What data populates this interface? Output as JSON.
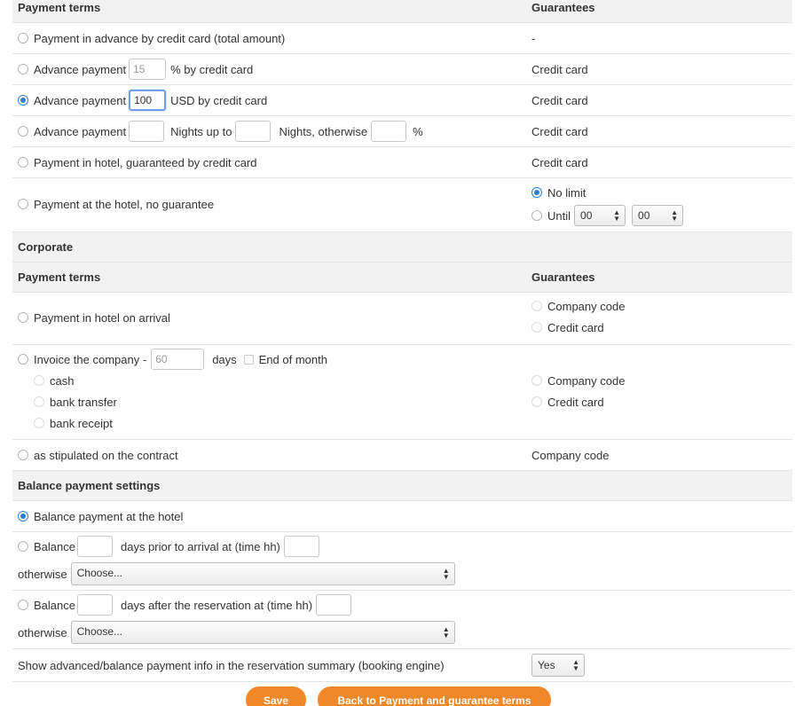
{
  "section_headers": {
    "payment_terms": "Payment terms",
    "guarantees": "Guarantees",
    "corporate": "Corporate",
    "corporate_payment_terms": "Payment terms",
    "corporate_guarantees": "Guarantees",
    "balance_settings": "Balance payment settings"
  },
  "payment_options": {
    "advance_total": {
      "label": "Payment in advance by credit card (total amount)",
      "guarantee": "-"
    },
    "advance_percent": {
      "label": "Advance payment",
      "value": "15",
      "suffix": "% by credit card",
      "guarantee": "Credit card"
    },
    "advance_usd": {
      "label": "Advance payment",
      "value": "100",
      "suffix": "USD by credit card",
      "guarantee": "Credit card"
    },
    "advance_nights": {
      "label": "Advance payment",
      "mid": "Nights up to",
      "end": "Nights, otherwise",
      "percent": "%",
      "guarantee": "Credit card"
    },
    "hotel_guaranteed": {
      "label": "Payment in hotel, guaranteed by credit card",
      "guarantee": "Credit card"
    },
    "hotel_no_guarantee": {
      "label": "Payment at the hotel, no guarantee",
      "no_limit": "No limit",
      "until": "Until",
      "hour": "00",
      "minute": "00"
    }
  },
  "corporate": {
    "on_arrival": {
      "label": "Payment in hotel on arrival",
      "g1": "Company code",
      "g2": "Credit card"
    },
    "invoice": {
      "label": "Invoice the company -",
      "days_value": "60",
      "days": "days",
      "end_of_month": "End of month",
      "methods": [
        "cash",
        "bank transfer",
        "bank receipt"
      ],
      "g1": "Company code",
      "g2": "Credit card"
    },
    "contract": {
      "label": "as stipulated on the contract",
      "guarantee": "Company code"
    }
  },
  "balance": {
    "at_hotel": "Balance payment at the hotel",
    "prior": {
      "label": "Balance",
      "mid": "days prior to arrival at (time hh)",
      "otherwise": "otherwise",
      "select": "Choose..."
    },
    "after": {
      "label": "Balance",
      "mid": "days after the reservation at (time hh)",
      "otherwise": "otherwise",
      "select": "Choose..."
    },
    "show_info": {
      "label": "Show advanced/balance payment info in the reservation summary (booking engine)",
      "value": "Yes"
    }
  },
  "buttons": {
    "save": "Save",
    "back": "Back to Payment and guarantee terms"
  },
  "colors": {
    "accent": "#f0882a",
    "radio": "#2a7fd4"
  }
}
